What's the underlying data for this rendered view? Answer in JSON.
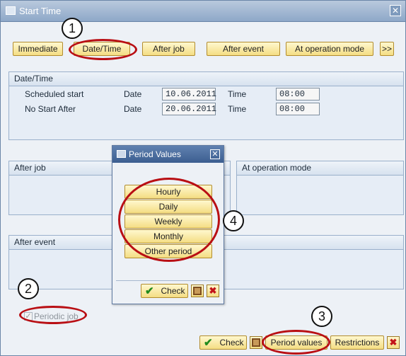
{
  "window": {
    "title": "Start Time",
    "close": "✕"
  },
  "toolbar": {
    "immediate": "Immediate",
    "date_time": "Date/Time",
    "after_job": "After job",
    "after_event": "After event",
    "at_operation_mode": "At operation mode",
    "more": ">>"
  },
  "date_time_section": {
    "title": "Date/Time",
    "rows": [
      {
        "label": "Scheduled start",
        "date_label": "Date",
        "date": "10.06.2011",
        "time_label": "Time",
        "time": "08:00"
      },
      {
        "label": "No Start After",
        "date_label": "Date",
        "date": "20.06.2011",
        "time_label": "Time",
        "time": "08:00"
      }
    ]
  },
  "after_job_section": {
    "title": "After job"
  },
  "at_operation_mode_section": {
    "title": "At operation mode"
  },
  "after_event_section": {
    "title": "After event"
  },
  "periodic_job": {
    "label": "Periodic job",
    "checked": true
  },
  "bottom_buttons": {
    "check": "Check",
    "period_values": "Period values",
    "restrictions": "Restrictions"
  },
  "dialog": {
    "title": "Period Values",
    "close": "✕",
    "options": [
      "Hourly",
      "Daily",
      "Weekly",
      "Monthly",
      "Other period"
    ],
    "check": "Check"
  },
  "annotations": [
    "1",
    "2",
    "3",
    "4"
  ],
  "colors": {
    "annotation_red": "#b90f14",
    "button_yellow": "#f4dd83",
    "title_blue": "#3c5e90"
  }
}
